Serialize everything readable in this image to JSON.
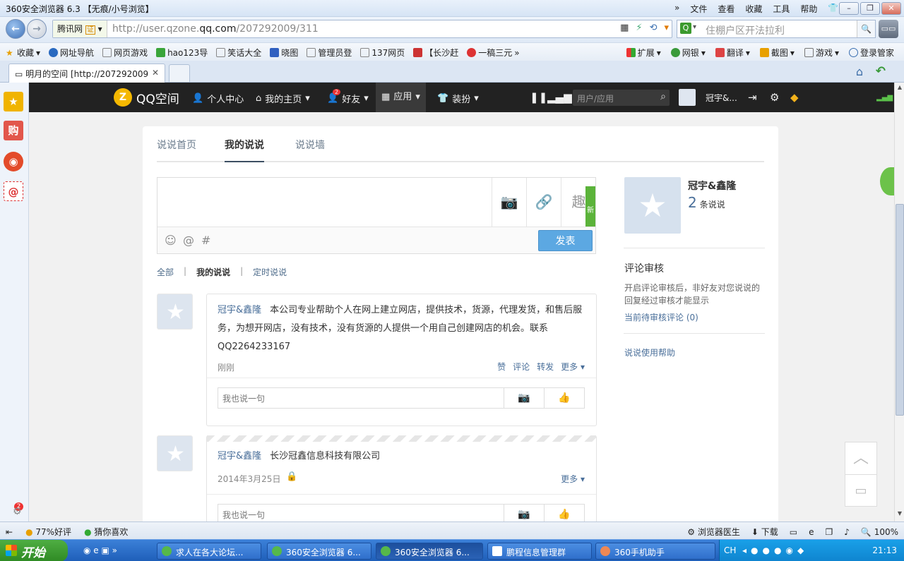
{
  "browser": {
    "title": "360安全浏览器 6.3 【无痕/小号浏览】",
    "menus": [
      "文件",
      "查看",
      "收藏",
      "工具",
      "帮助"
    ],
    "site_label": "腾讯网",
    "url_prefix": "http://user.qzone.",
    "url_domain": "qq.com",
    "url_path": "/207292009/311",
    "search_placeholder": "住棚户区开法拉利",
    "tab_title": "明月的空间 [http://207292009",
    "favorites": [
      "收藏",
      "网址导航",
      "网页游戏",
      "hao123导",
      "笑话大全",
      "晓图",
      "管理员登",
      "137网页",
      "【长沙赶",
      "一稿三元"
    ],
    "favorites_right": [
      "扩展",
      "网银",
      "翻译",
      "截图",
      "游戏",
      "登录管家"
    ]
  },
  "qq": {
    "logo": "QQ空间",
    "nav": [
      "个人中心",
      "我的主页",
      "好友",
      "应用",
      "装扮"
    ],
    "friend_badge": "2",
    "search_placeholder": "用户/应用",
    "user_name": "冠宇&..."
  },
  "subtabs": [
    "说说首页",
    "我的说说",
    "说说墙"
  ],
  "composer": {
    "new_badge": "新",
    "submit": "发表"
  },
  "filters": [
    "全部",
    "我的说说",
    "定时说说"
  ],
  "posts": [
    {
      "author": "冠宇&鑫隆",
      "text": "本公司专业帮助个人在网上建立网店，提供技术，货源，代理发货，和售后服务，为想开网店，没有技术，没有货源的人提供一个用自己创建网店的机会。联系QQ2264233167",
      "time": "刚刚",
      "actions": [
        "赞",
        "评论",
        "转发",
        "更多"
      ],
      "reply_placeholder": "我也说一句"
    },
    {
      "author": "冠宇&鑫隆",
      "text": "长沙冠鑫信息科技有限公司",
      "time": "2014年3月25日",
      "actions": [
        "更多"
      ],
      "reply_placeholder": "我也说一句"
    }
  ],
  "profile": {
    "name": "冠宇&鑫隆",
    "count": "2",
    "count_label": "条说说",
    "review_title": "评论审核",
    "review_desc": "开启评论审核后，非好友对您说说的回复经过审核才能显示",
    "pending_link": "当前待审核评论 (0)",
    "help_link": "说说使用帮助"
  },
  "statusbar": {
    "rating": "77%好评",
    "guess": "猜你喜欢",
    "doctor": "浏览器医生",
    "download": "下载",
    "zoom": "100%"
  },
  "taskbar": {
    "start": "开始",
    "tasks": [
      "求人在各大论坛...",
      "360安全浏览器 6...",
      "360安全浏览器 6...",
      "鹏程信息管理群",
      "360手机助手"
    ],
    "lang": "CH",
    "clock": "21:13"
  },
  "sidebar_badge": "2"
}
